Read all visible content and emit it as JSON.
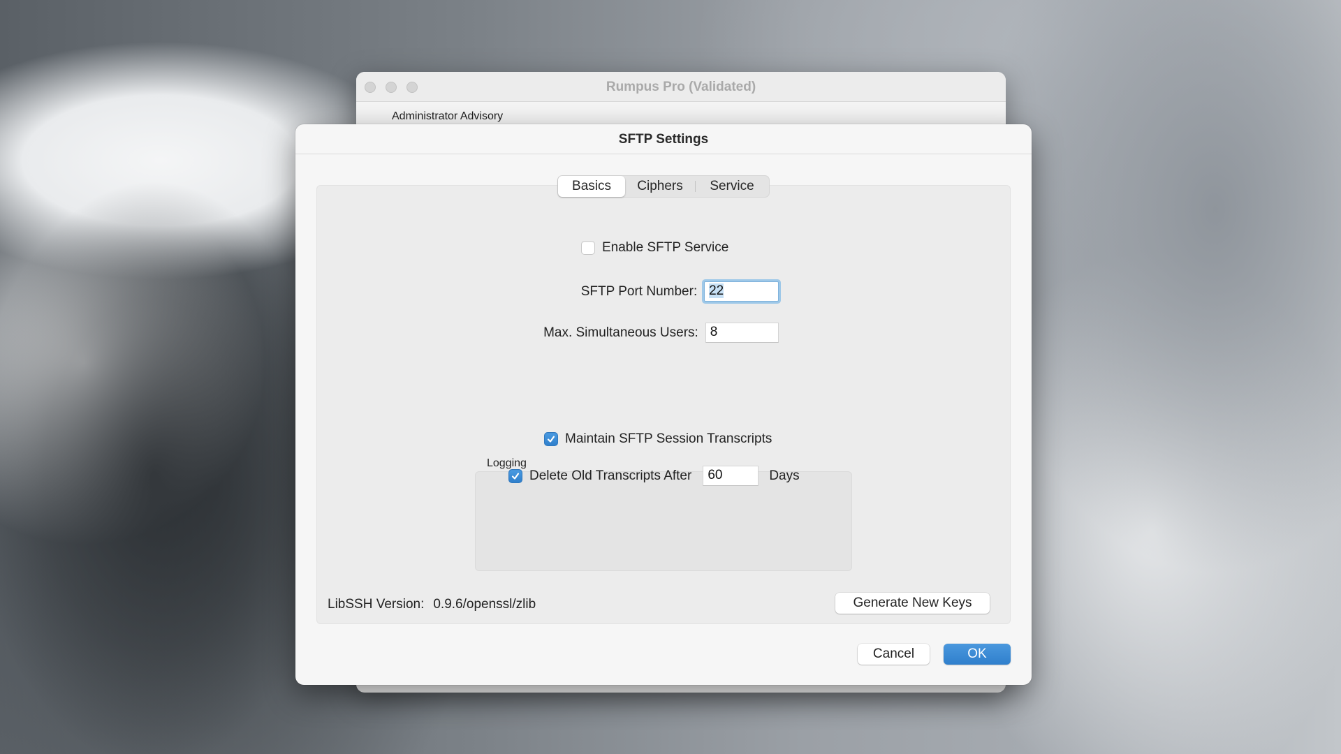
{
  "background_window": {
    "title": "Rumpus Pro (Validated)",
    "advisory_label": "Administrator Advisory",
    "traffic_lights": [
      "close-button",
      "minimize-button",
      "zoom-button"
    ]
  },
  "dialog": {
    "title": "SFTP Settings",
    "tabs": [
      {
        "label": "Basics",
        "active": true
      },
      {
        "label": "Ciphers",
        "active": false
      },
      {
        "label": "Service",
        "active": false
      }
    ],
    "enable_service": {
      "label": "Enable SFTP Service",
      "checked": false
    },
    "port": {
      "label": "SFTP Port Number:",
      "value": "22",
      "focused": true,
      "selected": true
    },
    "max_users": {
      "label": "Max. Simultaneous Users:",
      "value": "8"
    },
    "logging": {
      "group_label": "Logging",
      "maintain_transcripts": {
        "label": "Maintain SFTP Session Transcripts",
        "checked": true
      },
      "delete_old": {
        "label": "Delete Old Transcripts After",
        "checked": true,
        "value": "60",
        "unit": "Days"
      }
    },
    "libssh": {
      "label": "LibSSH Version:",
      "value": "0.9.6/openssl/zlib"
    },
    "generate_keys_label": "Generate New Keys",
    "cancel_label": "Cancel",
    "ok_label": "OK"
  },
  "colors": {
    "accent": "#3a8ad4",
    "focus_ring": "#9ec8e8",
    "dialog_bg": "#f6f6f6",
    "panel_bg": "#ececec"
  }
}
